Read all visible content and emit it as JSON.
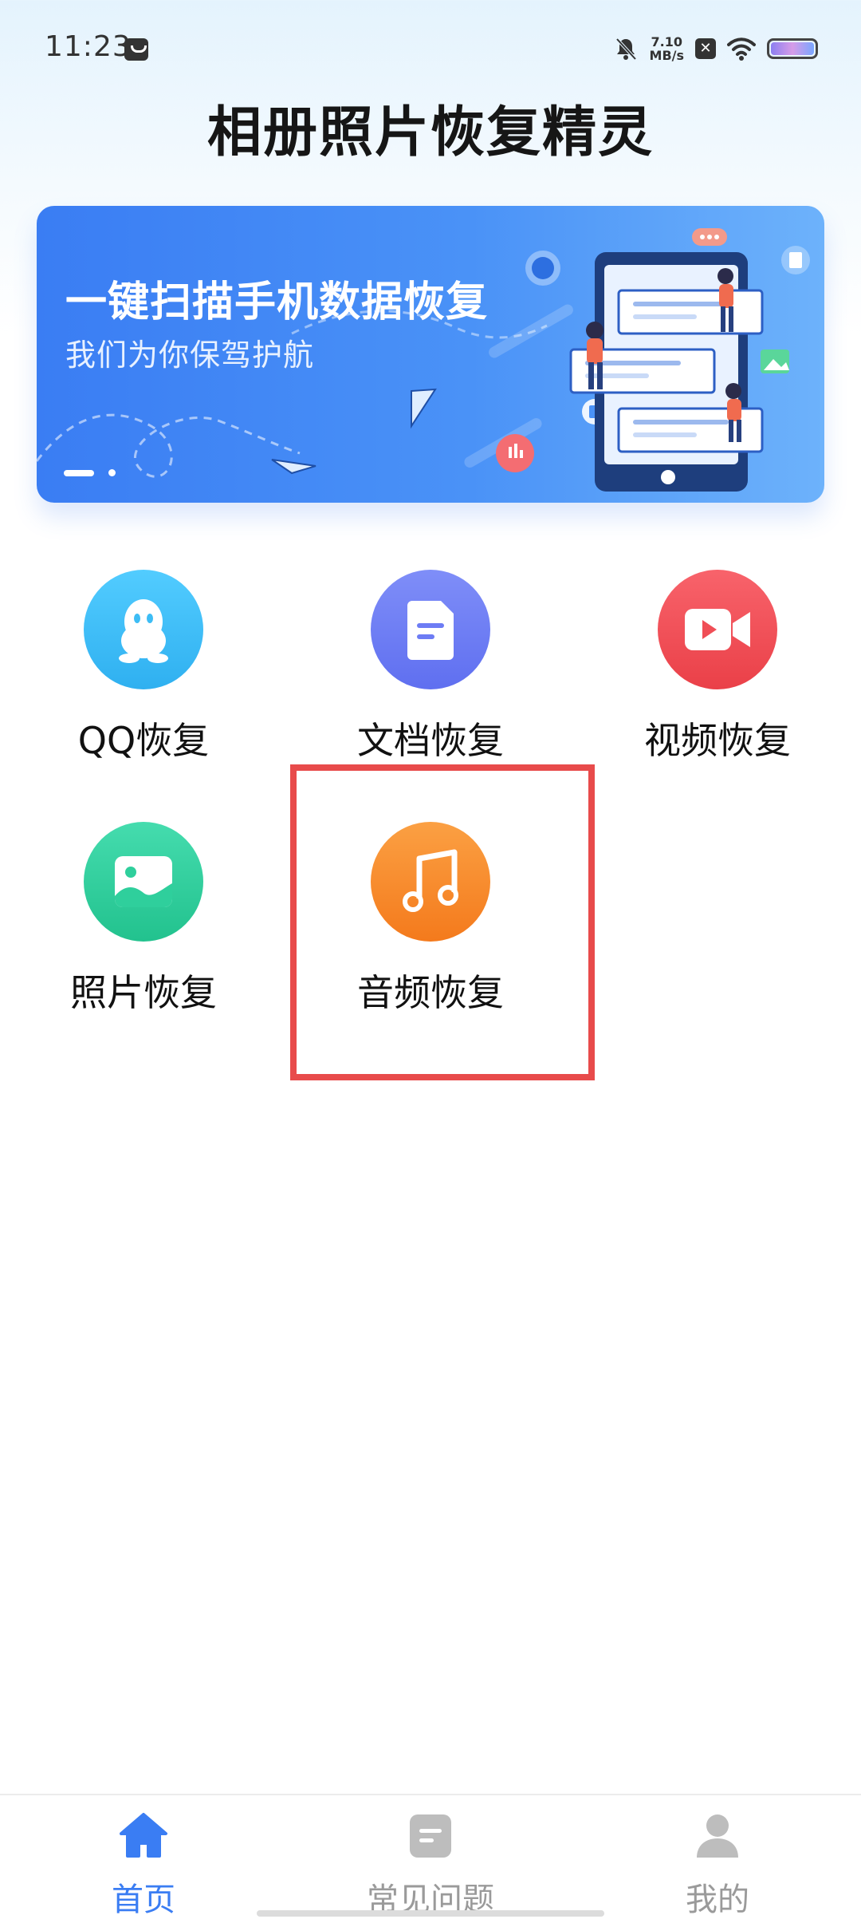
{
  "status_bar": {
    "time": "11:23",
    "net_speed_value": "7.10",
    "net_speed_unit": "MB/s"
  },
  "app": {
    "title": "相册照片恢复精灵"
  },
  "banner": {
    "headline": "一键扫描手机数据恢复",
    "subtitle": "我们为你保驾护航",
    "page_indicator": {
      "current": 1,
      "total": 2
    }
  },
  "features": [
    {
      "label": "QQ恢复",
      "icon": "qq-penguin-icon",
      "color": "#3dbdf5"
    },
    {
      "label": "文档恢复",
      "icon": "document-icon",
      "color": "#6d7cf4"
    },
    {
      "label": "视频恢复",
      "icon": "video-camera-icon",
      "color": "#f04e56"
    },
    {
      "label": "照片恢复",
      "icon": "image-icon",
      "color": "#2fcf9c"
    },
    {
      "label": "音频恢复",
      "icon": "music-note-icon",
      "color": "#f9892c"
    }
  ],
  "highlighted_feature": "音频恢复",
  "bottom_nav": {
    "items": [
      {
        "label": "首页",
        "icon": "home-icon",
        "active": true
      },
      {
        "label": "常见问题",
        "icon": "faq-doc-icon",
        "active": false
      },
      {
        "label": "我的",
        "icon": "user-icon",
        "active": false
      }
    ],
    "active_color": "#3a7df3",
    "inactive_color": "#9a9a9a"
  }
}
